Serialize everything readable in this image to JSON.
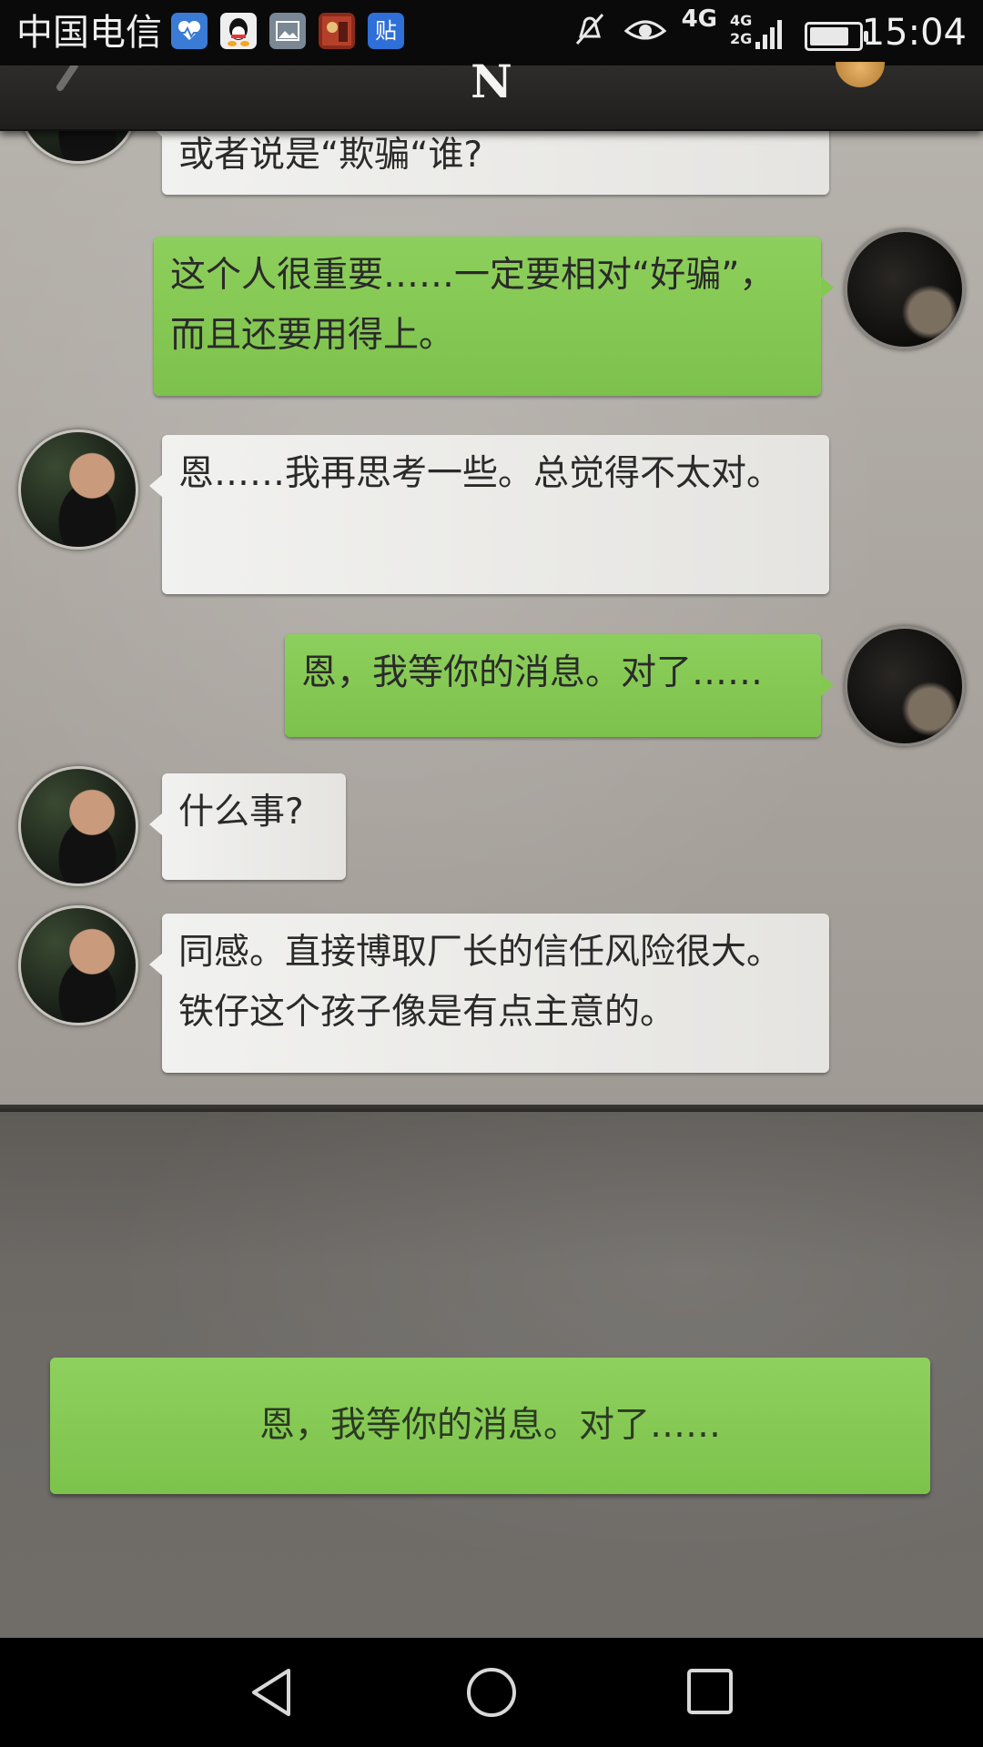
{
  "status_bar": {
    "carrier": "中国电信",
    "notification_icons": [
      "health-icon",
      "qq-icon",
      "gallery-icon",
      "app-icon",
      "tieba-icon"
    ],
    "tieba_glyph": "贴",
    "network": "4G",
    "signal_labels": "4G 2G",
    "time": "15:04",
    "battery_level": 0.82
  },
  "header": {
    "contact_name": "N"
  },
  "messages": [
    {
      "side": "in",
      "text": "或者说是“欺骗“谁?"
    },
    {
      "side": "out",
      "text": "这个人很重要……一定要相对“好骗”，而且还要用得上。"
    },
    {
      "side": "in",
      "text": "恩……我再思考一些。总觉得不太对。"
    },
    {
      "side": "out",
      "text": "恩，我等你的消息。对了……"
    },
    {
      "side": "in",
      "text": "什么事?"
    },
    {
      "side": "in",
      "text": "同感。直接博取厂长的信任风险很大。铁仔这个孩子像是有点主意的。"
    }
  ],
  "reply_option": {
    "text": "恩，我等你的消息。对了……"
  },
  "colors": {
    "outgoing_bubble": "#84c852",
    "incoming_bubble": "#ecebe8",
    "header_bg": "#262422",
    "status_bar_bg": "#0a0a0a"
  }
}
